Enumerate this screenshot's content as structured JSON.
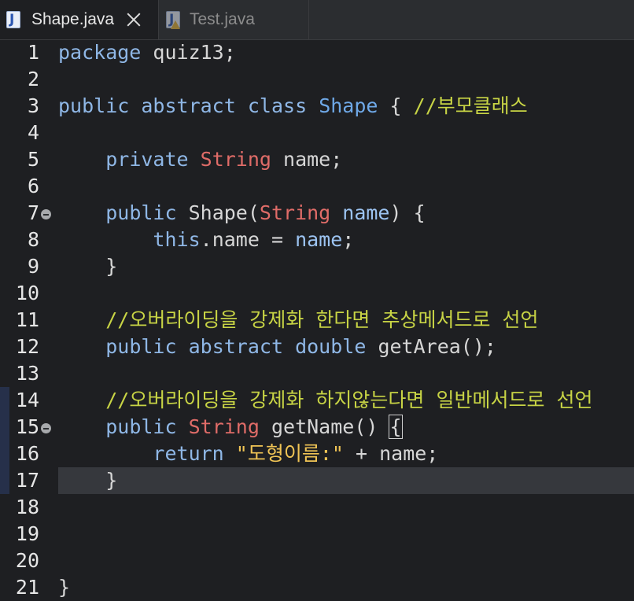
{
  "tabs": [
    {
      "label": "Shape.java",
      "active": true,
      "icon": "java-file-icon"
    },
    {
      "label": "Test.java",
      "active": false,
      "icon": "java-file-warning-icon"
    }
  ],
  "icon_glyph": "J",
  "editor": {
    "current_line": 17,
    "lines": [
      {
        "n": "1"
      },
      {
        "n": "2"
      },
      {
        "n": "3"
      },
      {
        "n": "4"
      },
      {
        "n": "5"
      },
      {
        "n": "6"
      },
      {
        "n": "7"
      },
      {
        "n": "8"
      },
      {
        "n": "9"
      },
      {
        "n": "10"
      },
      {
        "n": "11"
      },
      {
        "n": "12"
      },
      {
        "n": "13"
      },
      {
        "n": "14"
      },
      {
        "n": "15"
      },
      {
        "n": "16"
      },
      {
        "n": "17"
      },
      {
        "n": "18"
      },
      {
        "n": "19"
      },
      {
        "n": "20"
      },
      {
        "n": "21"
      }
    ],
    "code": {
      "l1": [
        "package",
        "quiz13;"
      ],
      "l3": [
        "public",
        "abstract",
        "class",
        "Shape",
        "{",
        "//부모클래스"
      ],
      "l5": [
        "private",
        "String",
        "name;"
      ],
      "l7": [
        "public",
        "Shape(",
        "String",
        "name",
        ") {"
      ],
      "l8": [
        "this",
        ".name = ",
        "name",
        ";"
      ],
      "l9": [
        "}"
      ],
      "l11": [
        "//오버라이딩을 강제화 한다면 추상메서드로 선언"
      ],
      "l12": [
        "public",
        "abstract",
        "double",
        "getArea();"
      ],
      "l14": [
        "//오버라이딩을 강제화 하지않는다면 일반메서드로 선언"
      ],
      "l15": [
        "public",
        "String",
        "getName() ",
        "{"
      ],
      "l16": [
        "return",
        "\"도형이름:\"",
        " + name;"
      ],
      "l17": [
        "}"
      ],
      "l21": [
        "}"
      ]
    }
  },
  "colors": {
    "keyword": "#8fb7e6",
    "string_type": "#e06c68",
    "comment": "#c8d445",
    "string_literal": "#f0c455",
    "class_name": "#6fa9e8"
  }
}
